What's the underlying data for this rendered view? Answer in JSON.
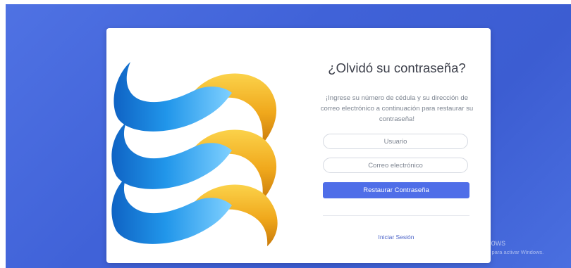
{
  "recovery": {
    "title": "¿Olvidó su contraseña?",
    "description": "¡Ingrese su número de cédula y su dirección de correo electrónico a continuación para restaurar su contraseña!",
    "user_placeholder": "Usuario",
    "email_placeholder": "Correo electrónico",
    "submit_label": "Restaurar Contraseña",
    "login_link": "Iniciar Sesión"
  },
  "watermark": {
    "title": "Activar Windows",
    "subtitle": "Ve a Configuración para activar Windows."
  },
  "colors": {
    "background": "#4062d8",
    "button": "#4f6ee8",
    "link": "#4c64c8",
    "logo_blue": "#1f8be0",
    "logo_gold": "#f0a81c"
  },
  "icons": {
    "logo": "stacked-blue-gold-waves-logo"
  }
}
